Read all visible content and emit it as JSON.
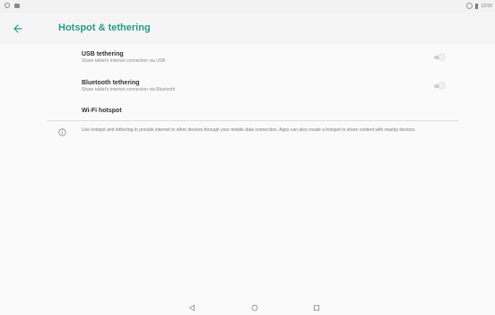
{
  "status_bar": {
    "time": "12:00",
    "left_icons": [
      "notification-ring-icon",
      "sd-card-icon"
    ],
    "right_icons": [
      "wifi-icon",
      "battery-icon"
    ]
  },
  "app_bar": {
    "title": "Hotspot & tethering",
    "back_icon": "arrow-left-icon"
  },
  "settings": {
    "usb": {
      "title": "USB tethering",
      "subtitle": "Share tablet's internet connection via USB",
      "enabled": false
    },
    "bluetooth": {
      "title": "Bluetooth tethering",
      "subtitle": "Share tablet's internet connection via Bluetooth",
      "enabled": false
    },
    "hotspot": {
      "title": "Wi-Fi hotspot"
    }
  },
  "info": {
    "icon": "info-icon",
    "text": "Use hotspot and tethering to provide internet to other devices through your mobile data connection. Apps can also create a hotspot to share content with nearby devices."
  },
  "nav_bar": {
    "icons": [
      "nav-back-icon",
      "nav-home-icon",
      "nav-recents-icon"
    ]
  },
  "colors": {
    "accent": "#26998b",
    "background": "#fafafa",
    "divider": "#dddddd"
  }
}
